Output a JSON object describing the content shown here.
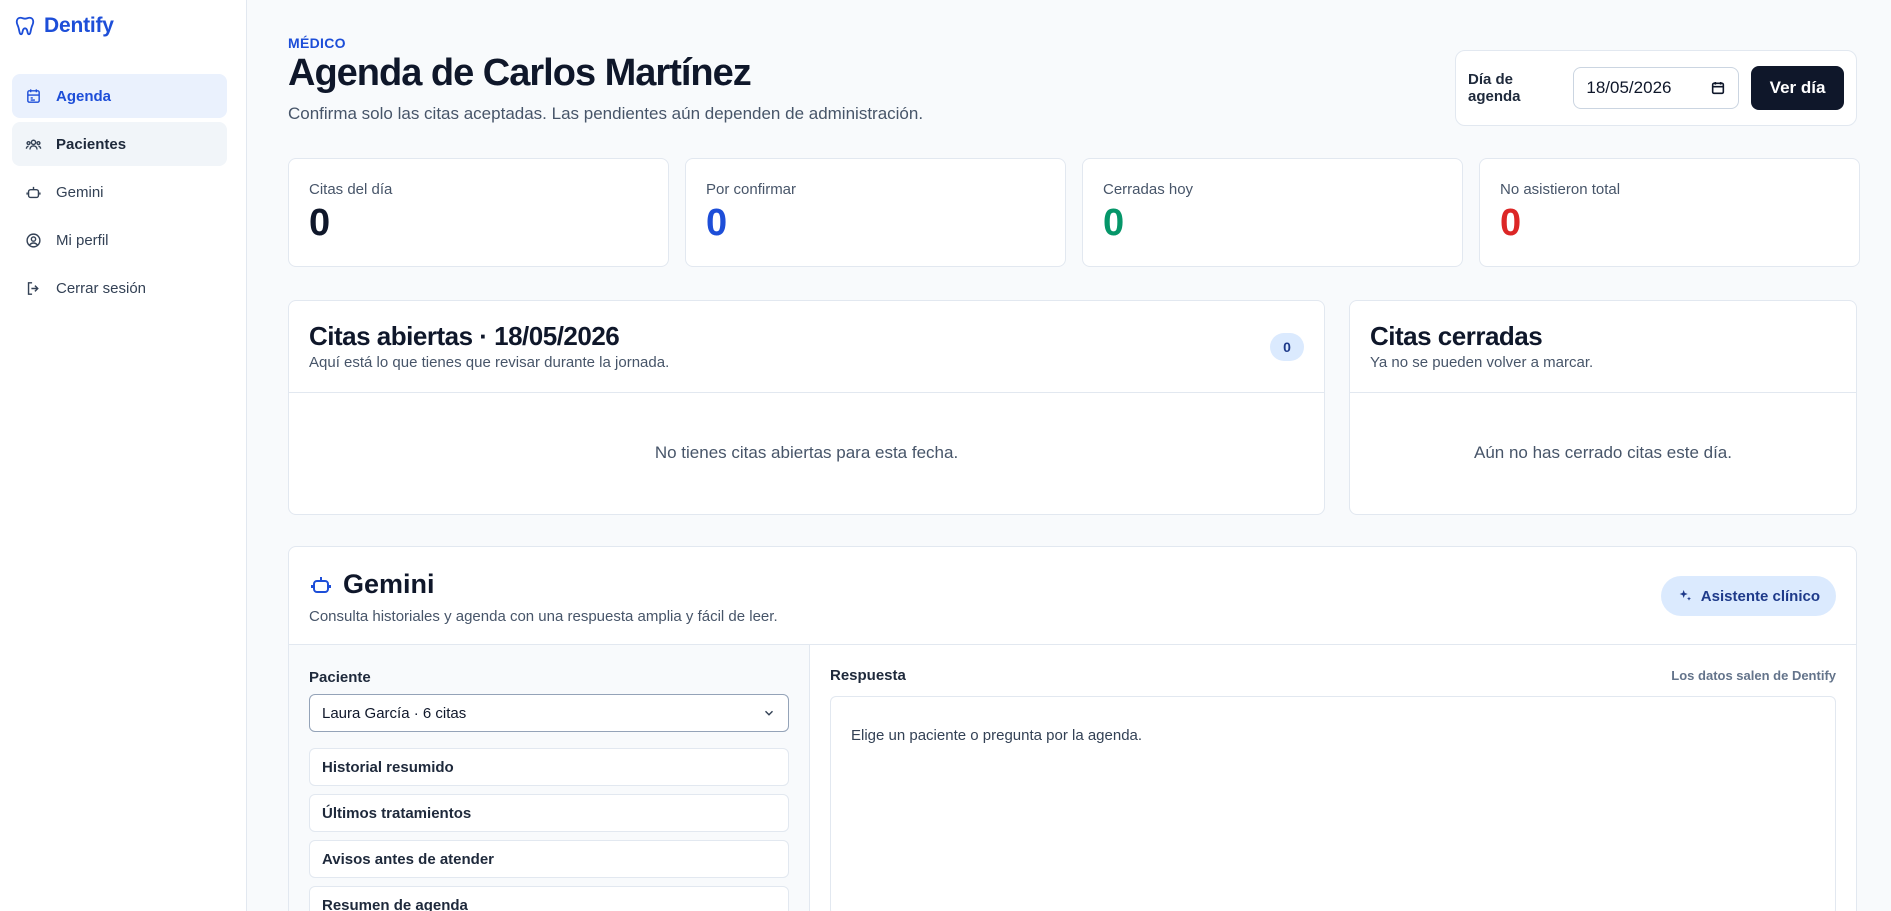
{
  "brand": {
    "name": "Dentify",
    "logo_icon": "tooth-icon",
    "color": "#1d4ed8"
  },
  "sidebar": {
    "items": [
      {
        "label": "Agenda",
        "icon": "calendar-icon",
        "state": "active"
      },
      {
        "label": "Pacientes",
        "icon": "users-icon",
        "state": "hover"
      },
      {
        "label": "Gemini",
        "icon": "bot-icon",
        "state": ""
      },
      {
        "label": "Mi perfil",
        "icon": "user-circle-icon",
        "state": ""
      },
      {
        "label": "Cerrar sesión",
        "icon": "logout-icon",
        "state": ""
      }
    ]
  },
  "header": {
    "eyebrow": "MÉDICO",
    "title": "Agenda de Carlos Martínez",
    "subtitle": "Confirma solo las citas aceptadas. Las pendientes aún dependen de administración."
  },
  "date_picker": {
    "label": "Día de agenda",
    "value": "18/05/2026",
    "button": "Ver día"
  },
  "stats": [
    {
      "label": "Citas del día",
      "value": "0",
      "color": "#0f172a"
    },
    {
      "label": "Por confirmar",
      "value": "0",
      "color": "#1d4ed8"
    },
    {
      "label": "Cerradas hoy",
      "value": "0",
      "color": "#059669"
    },
    {
      "label": "No asistieron total",
      "value": "0",
      "color": "#dc2626"
    }
  ],
  "open_panel": {
    "title": "Citas abiertas · 18/05/2026",
    "subtitle": "Aquí está lo que tienes que revisar durante la jornada.",
    "count": "0",
    "empty": "No tienes citas abiertas para esta fecha."
  },
  "closed_panel": {
    "title": "Citas cerradas",
    "subtitle": "Ya no se pueden volver a marcar.",
    "empty": "Aún no has cerrado citas este día."
  },
  "gemini": {
    "title": "Gemini",
    "subtitle": "Consulta historiales y agenda con una respuesta amplia y fácil de leer.",
    "assistant_button": "Asistente clínico",
    "patient_label": "Paciente",
    "patient_selected": "Laura García · 6 citas",
    "quick_actions": [
      "Historial resumido",
      "Últimos tratamientos",
      "Avisos antes de atender",
      "Resumen de agenda"
    ],
    "response_label": "Respuesta",
    "response_note": "Los datos salen de Dentify",
    "response_placeholder": "Elige un paciente o pregunta por la agenda."
  }
}
